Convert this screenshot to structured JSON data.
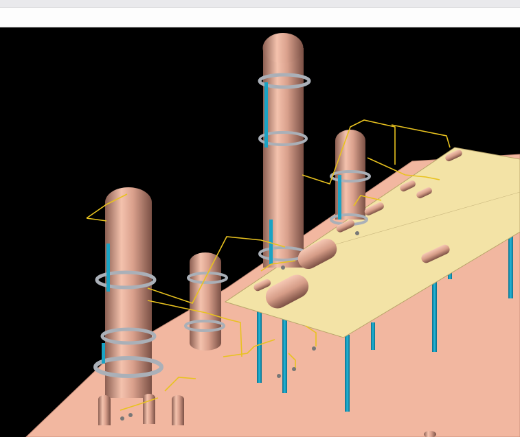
{
  "app": {
    "window_title": "",
    "toolbar_text": ""
  },
  "scene": {
    "background": "#000000",
    "colors": {
      "ground": "#f2b7a0",
      "deck": "#f3e3a6",
      "vessel": "#d9a08c",
      "pipe": "#e8c21f",
      "steel": "#1aa3c4",
      "platform": "#b9bec6"
    },
    "objects": [
      "ground-slab",
      "pipe-rack-deck",
      "tall-distillation-column",
      "left-column",
      "small-column",
      "right-column",
      "horizontal-drum-1",
      "horizontal-drum-2",
      "heat-exchangers",
      "pumps",
      "steel-columns",
      "piping"
    ]
  }
}
